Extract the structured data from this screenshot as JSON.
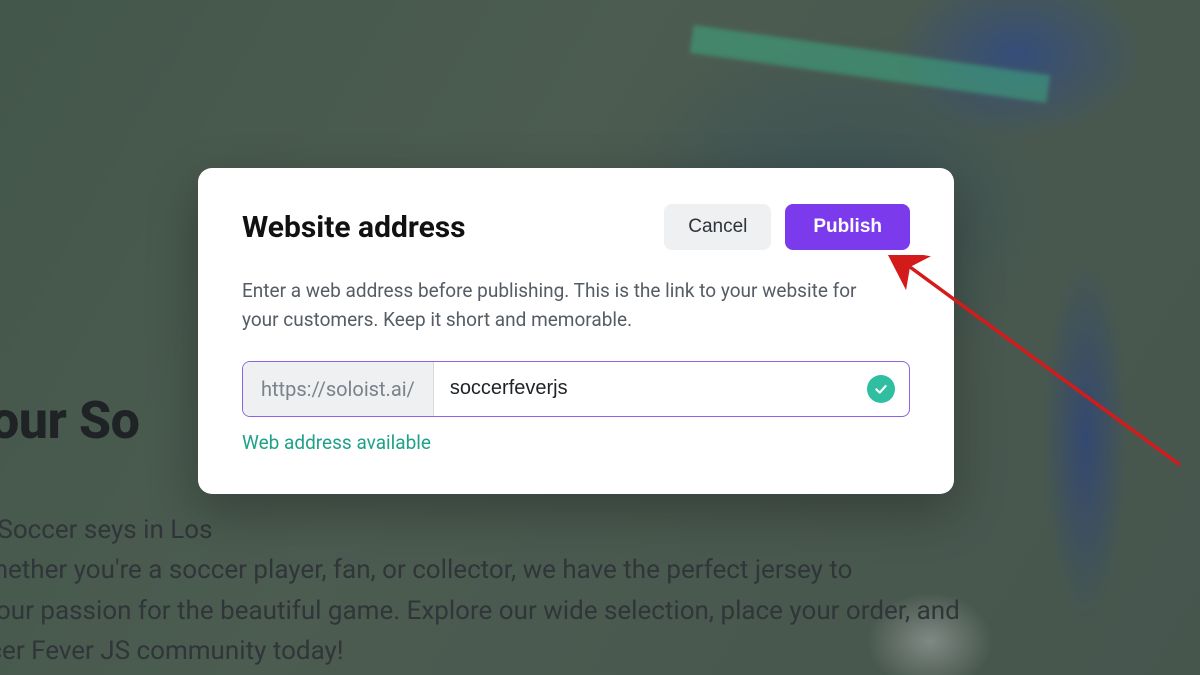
{
  "background": {
    "heading_fragment": "t Your So",
    "body_fragment": "ome to Soccer                                                                                                         seys in Los\neles. Whether you're a soccer player, fan, or collector, we have the perfect jersey to\nvcase your passion for the beautiful game. Explore our wide selection, place your order, and\nhe Soccer Fever JS community today!"
  },
  "modal": {
    "title": "Website address",
    "cancel_label": "Cancel",
    "publish_label": "Publish",
    "description": "Enter a web address before publishing. This is the link to your website for your customers. Keep it short and memorable.",
    "url_prefix": "https://soloist.ai/",
    "url_value": "soccerfeverjs",
    "status_message": "Web address available"
  },
  "colors": {
    "accent": "#7c3aed",
    "success": "#2fbfa0",
    "success_text": "#1fa189"
  }
}
